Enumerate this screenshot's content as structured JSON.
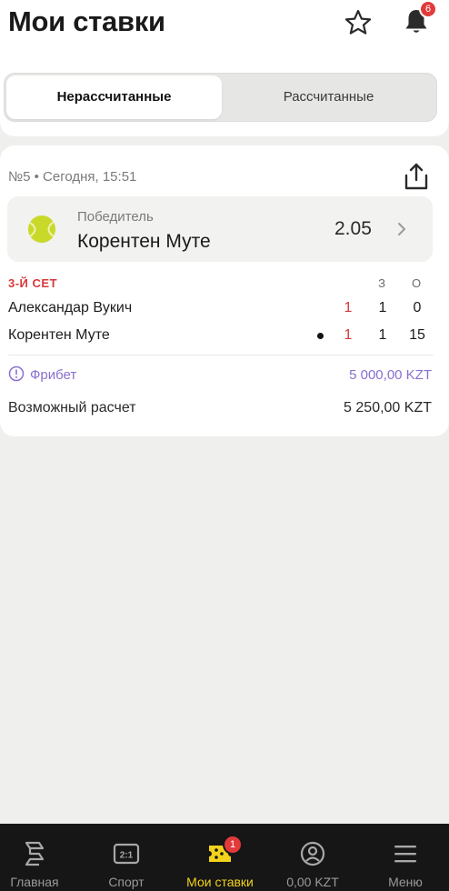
{
  "header": {
    "title": "Мои ставки",
    "notification_count": "6",
    "icons": {
      "favorite": "star-icon",
      "notifications": "bell-icon"
    }
  },
  "tabs": [
    {
      "label": "Нерассчитанные",
      "active": true
    },
    {
      "label": "Рассчитанные",
      "active": false
    }
  ],
  "bet": {
    "meta": "№5 • Сегодня, 15:51",
    "selection": {
      "market": "Победитель",
      "pick": "Корентен Муте",
      "odds": "2.05",
      "sport_icon": "tennis-ball-icon"
    },
    "scoreboard": {
      "period": "3-Й СЕТ",
      "columns": [
        "З",
        "О"
      ],
      "rows": [
        {
          "player": "Александар Вукич",
          "current": "1",
          "sets": "1",
          "points": "0",
          "serving": false
        },
        {
          "player": "Корентен Муте",
          "current": "1",
          "sets": "1",
          "points": "15",
          "serving": true
        }
      ]
    },
    "freebet": {
      "label": "Фрибет",
      "value": "5 000,00 KZT"
    },
    "payout": {
      "label": "Возможный расчет",
      "value": "5 250,00 KZT"
    }
  },
  "bottom_nav": [
    {
      "label": "Главная",
      "icon": "home-icon",
      "active": false
    },
    {
      "label": "Спорт",
      "icon": "scoreboard-icon",
      "active": false
    },
    {
      "label": "Мои ставки",
      "icon": "coupon-icon",
      "active": true,
      "badge": "1"
    },
    {
      "label": "0,00 KZT",
      "icon": "account-icon",
      "active": false
    },
    {
      "label": "Меню",
      "icon": "menu-icon",
      "active": false
    }
  ],
  "colors": {
    "accent": "#f2d21b",
    "live": "#d63a3a",
    "freebet": "#8a6fd0",
    "nav_bg": "#161616"
  }
}
